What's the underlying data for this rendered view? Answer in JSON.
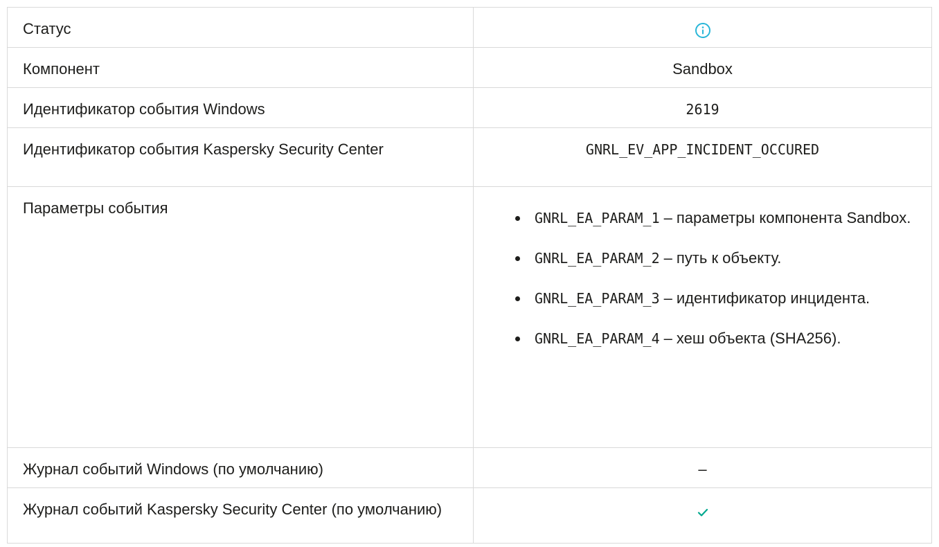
{
  "rows": {
    "status": {
      "label": "Статус",
      "icon": "info-icon",
      "icon_color": "#29b6d8"
    },
    "component": {
      "label": "Компонент",
      "value": "Sandbox"
    },
    "windows_event_id": {
      "label": "Идентификатор события Windows",
      "value": "2619"
    },
    "ksc_event_id": {
      "label": "Идентификатор события Kaspersky Security Center",
      "value": "GNRL_EV_APP_INCIDENT_OCCURED"
    },
    "event_params": {
      "label": "Параметры события",
      "items": [
        {
          "code": "GNRL_EA_PARAM_1",
          "sep": "–",
          "text": "параметры компонента Sandbox."
        },
        {
          "code": "GNRL_EA_PARAM_2",
          "sep": "–",
          "text": "путь к объекту."
        },
        {
          "code": "GNRL_EA_PARAM_3",
          "sep": "–",
          "text": "идентификатор инцидента."
        },
        {
          "code": "GNRL_EA_PARAM_4",
          "sep": "–",
          "text": "хеш объекта (SHA256)."
        }
      ]
    },
    "windows_log": {
      "label": "Журнал событий Windows (по умолчанию)",
      "value": "–"
    },
    "ksc_log": {
      "label": "Журнал событий Kaspersky Security Center (по умолчанию)",
      "icon": "check-icon",
      "icon_color": "#00a88e"
    }
  }
}
